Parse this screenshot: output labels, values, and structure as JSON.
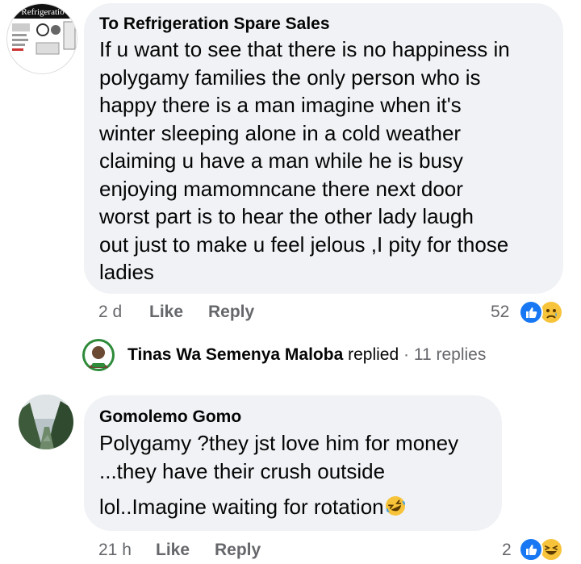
{
  "comment1": {
    "author": "To Refrigeration Spare Sales",
    "avatar_text": "Refrigeratio",
    "lines": [
      "If u want to see that there is no happiness in",
      "polygamy families the only person who is",
      "happy there is a man imagine when it's",
      "winter sleeping alone in a cold weather",
      "claiming u have a man while he is busy",
      "enjoying mamomncane there next door",
      "worst part is to hear the other lady laugh",
      "out just to make u feel jelous ,I pity for those",
      "ladies"
    ],
    "time": "2 d",
    "like_label": "Like",
    "reply_label": "Reply",
    "reaction_count": "52",
    "reactions": [
      "like-icon",
      "sad-icon"
    ]
  },
  "replies_row": {
    "name": "Tinas Wa Semenya Maloba",
    "replied_text": "replied",
    "separator": "·",
    "count_text": "11 replies"
  },
  "comment2": {
    "author": "Gomolemo Gomo",
    "lines": [
      "Polygamy ?they jst love him for money",
      "...they have their crush outside"
    ],
    "line3": "lol..Imagine waiting for rotation",
    "emoji": "rolling-on-floor-laughing-icon",
    "time": "21 h",
    "like_label": "Like",
    "reply_label": "Reply",
    "reaction_count": "2",
    "reactions": [
      "like-icon",
      "haha-icon"
    ]
  },
  "colors": {
    "bubble": "#f0f2f5",
    "meta": "#65676b",
    "like_blue": "#1877f2",
    "emoji_yellow": "#f7c33a"
  }
}
